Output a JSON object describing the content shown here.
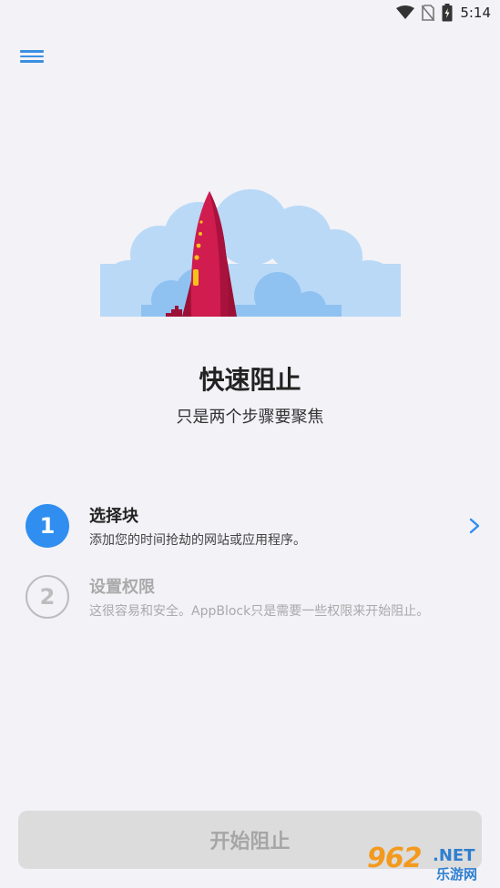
{
  "status_bar": {
    "time": "5:14",
    "icons": [
      "wifi-icon",
      "no-sim-icon",
      "battery-charging-icon"
    ]
  },
  "header": {
    "menu_icon": "hamburger-menu-icon"
  },
  "hero": {
    "title": "快速阻止",
    "subtitle": "只是两个步骤要聚焦"
  },
  "steps": [
    {
      "number": "1",
      "title": "选择块",
      "description": "添加您的时间抢劫的网站或应用程序。",
      "active": true
    },
    {
      "number": "2",
      "title": "设置权限",
      "description": "这很容易和安全。AppBlock只是需要一些权限来开始阻止。",
      "active": false
    }
  ],
  "footer": {
    "start_label": "开始阻止"
  },
  "watermark": {
    "number": "962",
    "net": ".NET",
    "site": "乐游网"
  },
  "colors": {
    "accent": "#2f8ef0",
    "background": "#f2f2f7",
    "rocket": "#c8194b",
    "cloud": "#b9d9f7"
  }
}
